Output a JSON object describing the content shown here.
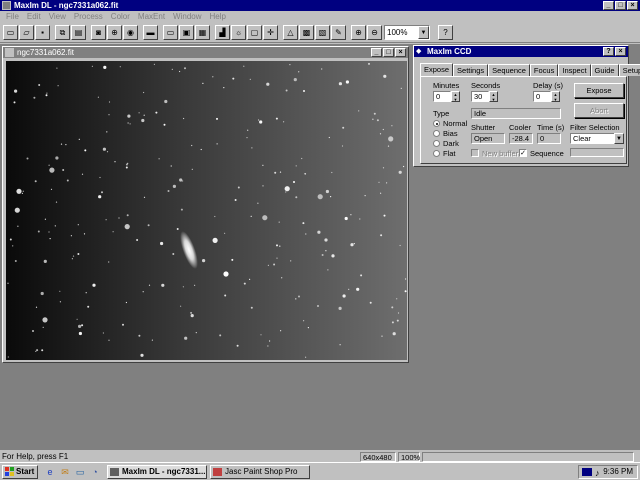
{
  "app": {
    "title": "MaxIm DL - ngc7331a062.fit"
  },
  "menu": [
    "File",
    "Edit",
    "View",
    "Process",
    "Color",
    "MaxEnt",
    "Window",
    "Help"
  ],
  "toolbar": {
    "zoom": "100%"
  },
  "image_window": {
    "title": "ngc7331a062.fit"
  },
  "ccd": {
    "title": "MaxIm CCD",
    "tabs": [
      "Expose",
      "Settings",
      "Sequence",
      "Focus",
      "Inspect",
      "Guide",
      "Setup"
    ],
    "minutes_label": "Minutes",
    "minutes": "0",
    "seconds_label": "Seconds",
    "seconds": "30",
    "delay_label": "Delay (s)",
    "delay": "0",
    "status": "Idle",
    "type_label": "Type",
    "types": [
      "Normal",
      "Bias",
      "Dark",
      "Flat"
    ],
    "shutter_label": "Shutter",
    "shutter": "Open",
    "cooler_label": "Cooler",
    "cooler": "-28.4",
    "time_label": "Time (s)",
    "time": "0",
    "expose_button": "Expose",
    "abort_button": "Abort",
    "filter_label": "Filter Selection",
    "filter": "Clear",
    "new_buffer": "New buffer",
    "sequence": "Sequence"
  },
  "statusbar": {
    "text": "For Help, press F1",
    "size": "640x480",
    "zoom": "100%"
  },
  "taskbar": {
    "start": "Start",
    "tasks": [
      "MaxIm DL - ngc7331...",
      "Jasc Paint Shop Pro"
    ],
    "clock": "9:36 PM"
  }
}
